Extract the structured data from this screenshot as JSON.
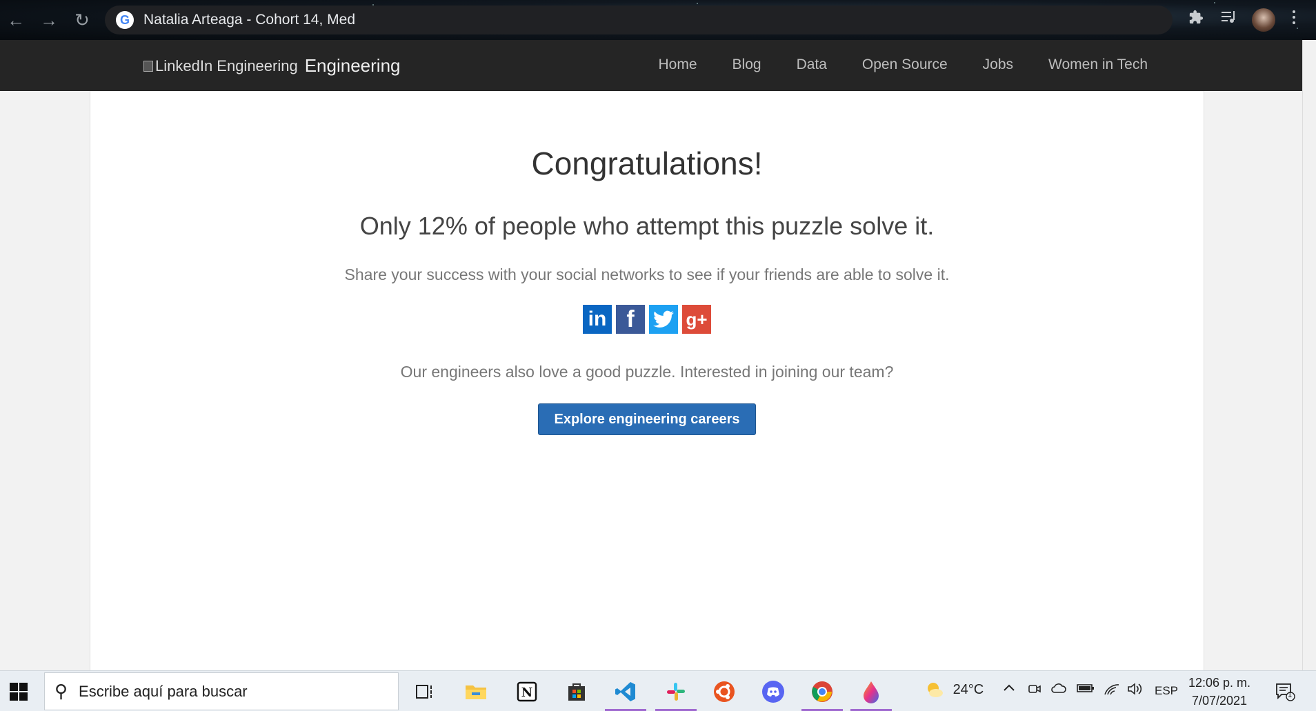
{
  "browser": {
    "omnibox_text": "Natalia Arteaga - Cohort 14, Med",
    "back_icon": "←",
    "forward_icon": "→",
    "reload_icon": "↻"
  },
  "site": {
    "logo_alt": "LinkedIn Engineering",
    "logo_text": "Engineering",
    "nav": [
      "Home",
      "Blog",
      "Data",
      "Open Source",
      "Jobs",
      "Women in Tech"
    ]
  },
  "content": {
    "title": "Congratulations!",
    "subtitle": "Only 12% of people who attempt this puzzle solve it.",
    "share_text": "Share your success with your social networks to see if your friends are able to solve it.",
    "social": {
      "linkedin": "in",
      "facebook": "f",
      "twitter": "t",
      "googleplus": "g+"
    },
    "join_text": "Our engineers also love a good puzzle. Interested in joining our team?",
    "cta_label": "Explore engineering careers"
  },
  "taskbar": {
    "search_placeholder": "Escribe aquí para buscar",
    "weather": "24°C",
    "language": "ESP",
    "time": "12:06 p. m.",
    "date": "7/07/2021",
    "notification_count": "1"
  },
  "colors": {
    "linkedin": "#0a66c2",
    "facebook": "#3b5998",
    "twitter": "#1da1f2",
    "googleplus": "#dd4b39",
    "cta": "#2a6db5"
  }
}
